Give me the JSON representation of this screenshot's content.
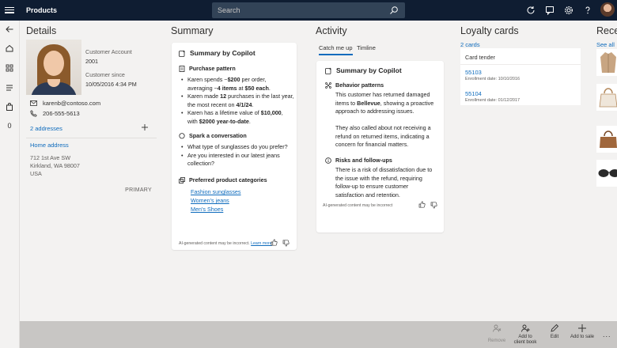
{
  "topbar": {
    "title": "Products",
    "search_placeholder": "Search"
  },
  "details": {
    "title": "Details",
    "customer_account_label": "Customer Account",
    "customer_account": "2001",
    "customer_since_label": "Customer since",
    "customer_since": "10/05/2016 4:34 PM",
    "email": "karenb@contoso.com",
    "phone": "206-555-5613",
    "addresses_count": "2 addresses",
    "home_address_label": "Home address",
    "address_line1": "712 1st Ave SW",
    "address_line2": "Kirkland, WA 98007",
    "address_line3": "USA",
    "primary_label": "PRIMARY"
  },
  "summary": {
    "title": "Summary",
    "copilot_title": "Summary by Copilot",
    "purchase_pattern_title": "Purchase pattern",
    "purchase_bullets": [
      {
        "a": "Karen spends ~",
        "b": "$200",
        "c": " per order,"
      },
      {
        "a": "averaging ~",
        "b": "4 items",
        "c": " at ",
        "d": "$50 each",
        "e": "."
      },
      {
        "a": "Karen made ",
        "b": "12",
        "c": " purchases in the last year,"
      },
      {
        "a": "the most recent on ",
        "b": "4/1/24",
        "c": "."
      },
      {
        "a": "Karen has a lifetime value of ",
        "b": "$10,000",
        "c": ","
      },
      {
        "a": "with ",
        "b": "$2000 year-to-date",
        "c": "."
      }
    ],
    "spark_title": "Spark a conversation",
    "spark_bullets": [
      "What type of sunglasses do you prefer?",
      "Are you interested in our latest jeans",
      "collection?"
    ],
    "categories_title": "Preferred product categories",
    "categories": [
      "Fashion sunglasses",
      "Women's jeans",
      "Men's Shoes"
    ],
    "disclaimer": "AI-generated content may be incorrect.",
    "learn_more": "Learn more"
  },
  "activity": {
    "title": "Activity",
    "tabs": [
      "Catch me up",
      "Timline"
    ],
    "copilot_title": "Summary by Copilot",
    "behavior_title": "Behavior patterns",
    "behavior_lines": [
      "This customer has returned damaged",
      "items to Bellevue, showing a proactive",
      "approach to addressing issues.",
      "",
      "They also called about not receiving a",
      "refund on returned items, indicating a",
      "concern for financial matters."
    ],
    "risks_title": "Risks and follow-ups",
    "risks_lines": [
      "There is a risk of dissatisfaction due to",
      "the issue with the refund, requiring",
      "follow-up to ensure customer",
      "satisfaction and retention."
    ],
    "disclaimer": "AI-generated content may be incorrect"
  },
  "loyalty": {
    "title": "Loyalty cards",
    "count": "2 cards",
    "tender_label": "Card tender",
    "cards": [
      {
        "number": "55103",
        "date": "Enrollment date: 10/10/2016"
      },
      {
        "number": "55104",
        "date": "Enrollment date: 01/12/2017"
      }
    ]
  },
  "recent": {
    "title": "Rece",
    "see_all": "See all"
  },
  "commands": {
    "remove": "Remove",
    "add_to_client_book_1": "Add to",
    "add_to_client_book_2": "client book",
    "edit": "Edit",
    "add_to_sale": "Add to sale",
    "more": "..."
  },
  "colors": {
    "topbar": "#0f1d32",
    "accent": "#0f6cbd",
    "cmdbar": "#c8c6c4"
  }
}
